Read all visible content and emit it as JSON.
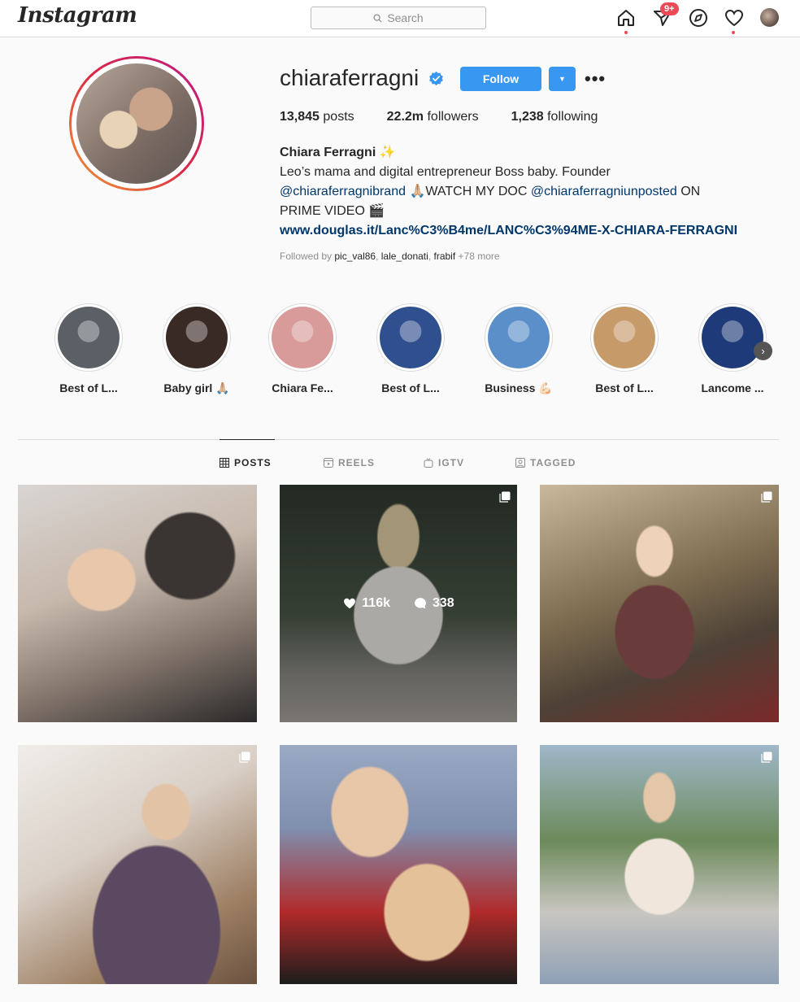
{
  "nav": {
    "logo": "Instagram",
    "search_placeholder": "Search",
    "notif_count": "9+"
  },
  "profile": {
    "username": "chiaraferragni",
    "follow_label": "Follow",
    "more_label": "•••",
    "stats": {
      "posts_value": "13,845",
      "posts_label": "posts",
      "followers_value": "22.2m",
      "followers_label": "followers",
      "following_value": "1,238",
      "following_label": "following"
    },
    "bio": {
      "name": "Chiara Ferragni ✨",
      "line1": "Leo’s mama and digital entrepreneur Boss baby. Founder",
      "mention1": "@chiaraferragnibrand",
      "text2": " 🙏🏼WATCH MY DOC ",
      "mention2": "@chiaraferragniunposted",
      "text3": " ON",
      "line3": "PRIME VIDEO 🎬",
      "link": "www.douglas.it/Lanc%C3%B4me/LANC%C3%94ME-X-CHIARA-FERRAGNI"
    },
    "followed_by": {
      "prefix": "Followed by ",
      "user1": "pic_val86",
      "sep1": ", ",
      "user2": "lale_donati",
      "sep2": ", ",
      "user3": "frabif",
      "suffix": " +78 more"
    }
  },
  "highlights": [
    {
      "label": "Best of L...",
      "color": "#5b5f66"
    },
    {
      "label": "Baby girl 🙏🏼",
      "color": "#3a2a26"
    },
    {
      "label": "Chiara Fe...",
      "color": "#d99a9a"
    },
    {
      "label": "Best of L...",
      "color": "#2f4f8f"
    },
    {
      "label": "Business 💪🏻",
      "color": "#5a8fc9"
    },
    {
      "label": "Best of L...",
      "color": "#c79a6a"
    },
    {
      "label": "Lancome ...",
      "color": "#1f3a78"
    }
  ],
  "tabs": {
    "posts": "POSTS",
    "reels": "REELS",
    "igtv": "IGTV",
    "tagged": "TAGGED"
  },
  "hover_post": {
    "likes": "116k",
    "comments": "338"
  }
}
